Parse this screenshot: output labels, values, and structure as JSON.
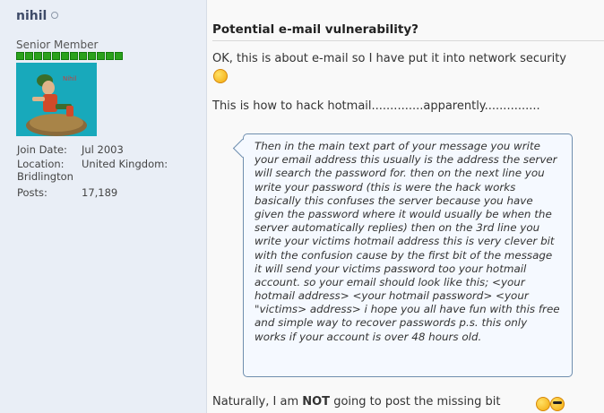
{
  "user": {
    "name": "nihil",
    "title": "Senior Member",
    "rep_bars": 12,
    "avatar_label": "Nihil",
    "join_label": "Join Date:",
    "join_value": "Jul 2003",
    "location_label": "Location:",
    "location_value": "United Kingdom:",
    "location_value2": "Bridlington",
    "posts_label": "Posts:",
    "posts_value": "17,189"
  },
  "post": {
    "title": "Potential e-mail vulnerability?",
    "line1": "OK, this is about e-mail so I have put it into network security",
    "line2": "This is how to hack hotmail..............apparently...............",
    "quote_lines": [
      "Then in the main text part of your message you write",
      "your email address this usually is the address the server",
      "will search the password for. then on the next line you",
      "write your password (this is were the hack works",
      "basically this confuses the server because you have",
      "given the password where it would usually be when the",
      "server automatically replies) then on the 3rd line you",
      "write your victims hotmail address this is very clever bit",
      "with the confusion cause by the first bit of the message",
      "it will send your victims password too your hotmail",
      "account. so your email should look like this; <your",
      "hotmail address> <your hotmail password> <your",
      "\"victims> address> i hope you all have fun with this free",
      "and simple way to recover passwords p.s. this only",
      "works if your account is over 48 hours old."
    ],
    "closing_pre": "Naturally, I am ",
    "closing_bold": "NOT",
    "closing_post": " going to post the missing bit"
  },
  "icons": {
    "smiley": "smiley-wink-icon",
    "sunglasses": "smiley-cool-icon"
  },
  "colors": {
    "username": "#3e4b68",
    "rep_green": "#2aa11c",
    "quote_border": "#6f8eae",
    "sidebar_bg": "#e9eef6",
    "post_bg": "#f9f9f9"
  }
}
